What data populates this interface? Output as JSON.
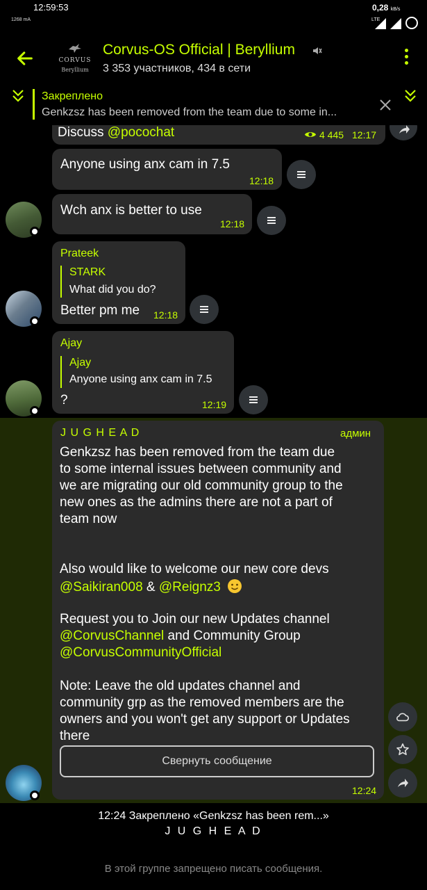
{
  "status_bar": {
    "time": "12:59:53",
    "battery_info": "1268 mA",
    "net_speed_value": "0,28",
    "net_speed_unit": "kB/s",
    "network": "LTE"
  },
  "header": {
    "title": "Corvus-OS Official | Beryllium",
    "subtitle": "3 353 участников, 434 в сети",
    "logo_line1": "CORVUS",
    "logo_line2": "Beryllium"
  },
  "pinned": {
    "label": "Закреплено",
    "text": "Genkzsz has been removed from the team due to some in..."
  },
  "messages": [
    {
      "text_prefix": "Discuss ",
      "mention": "@pocochat",
      "views": "4 445",
      "time": "12:17"
    },
    {
      "text": "Anyone using anx cam in 7.5",
      "time": "12:18"
    },
    {
      "text": "Wch anx is better to use",
      "time": "12:18"
    },
    {
      "sender": "Prateek",
      "reply_name": "STARK",
      "reply_text": "What did you do?",
      "text": "Better pm me",
      "time": "12:18"
    },
    {
      "sender": "Ajay",
      "reply_name": "Ajay",
      "reply_text": "Anyone using anx cam in 7.5",
      "text": "?",
      "time": "12:19"
    }
  ],
  "admin_message": {
    "sender": "J U G H E A D",
    "role": "админ",
    "p1": [
      "Genkzsz has been removed from the team due",
      "to some internal issues between community and",
      "we are migrating our old community group to the",
      "new ones as the admins there are not a part of",
      "team now"
    ],
    "p2_line1": "Also would like to welcome our new core devs",
    "p2_mention1": "@Saikiran008",
    "p2_amp": " & ",
    "p2_mention2": "@Reignz3",
    "p3_line1": "Request you to Join our new Updates channel",
    "p3_mention1": "@CorvusChannel",
    "p3_mid": " and Community Group",
    "p3_mention2": "@CorvusCommunityOfficial",
    "p4": [
      "Note: Leave the old updates channel and",
      "community grp as the removed members are the",
      "owners and you won't get any support or Updates",
      "there"
    ],
    "collapse_label": "Свернуть сообщение",
    "time": "12:24"
  },
  "footer": {
    "system_line1": "12:24 Закреплено «Genkzsz has been rem...»",
    "system_line2": "J U G H E A D",
    "restriction": "В этой группе запрещено писать сообщения."
  },
  "colors": {
    "accent": "#c6ff00",
    "bubble": "#2b2b2b",
    "highlight": "#1f2a05",
    "background": "#000000"
  },
  "icons": [
    "back-arrow-icon",
    "mute-icon",
    "more-vert-icon",
    "chevron-down-icon",
    "close-icon",
    "eye-icon",
    "share-icon",
    "transcribe-icon",
    "cloud-icon",
    "star-icon",
    "smile-emoji-icon"
  ]
}
